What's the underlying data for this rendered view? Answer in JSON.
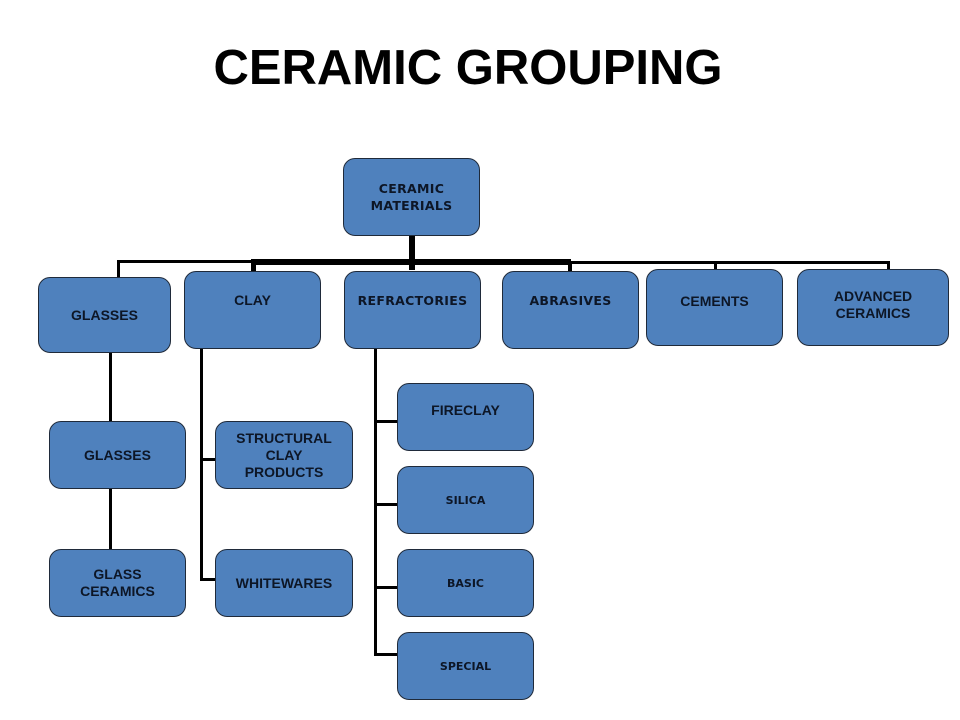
{
  "title": "CERAMIC GROUPING",
  "colors": {
    "node_fill": "#4f81bd",
    "node_border": "#1f2a3a",
    "text": "#0d1626",
    "connector": "#000000"
  },
  "root": {
    "label": "CERAMIC\nMATERIALS"
  },
  "categories": [
    {
      "label": "GLASSES",
      "children": [
        "GLASSES",
        "GLASS\nCERAMICS"
      ]
    },
    {
      "label": "CLAY",
      "children": [
        "STRUCTURAL\nCLAY\nPRODUCTS",
        "WHITEWARES"
      ]
    },
    {
      "label": "REFRACTORIES",
      "children": [
        "FIRECLAY",
        "SILICA",
        "BASIC",
        "SPECIAL"
      ]
    },
    {
      "label": "ABRASIVES",
      "children": []
    },
    {
      "label": "CEMENTS",
      "children": []
    },
    {
      "label": "ADVANCED\nCERAMICS",
      "children": []
    }
  ]
}
